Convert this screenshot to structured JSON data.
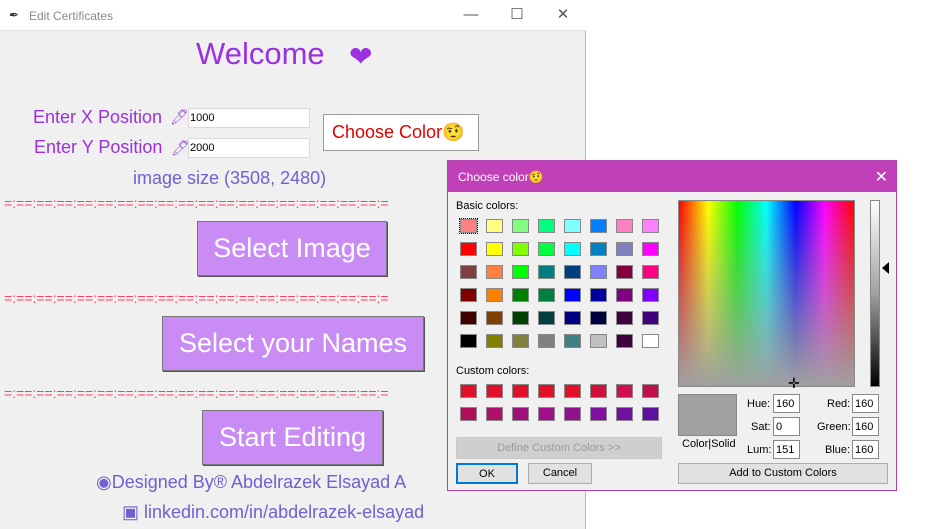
{
  "main_window": {
    "title": "Edit Certificates",
    "controls": {
      "minimize": "—",
      "maximize": "☐",
      "close": "✕"
    },
    "welcome": "Welcome",
    "heart": "❤",
    "x_label": "Enter X Position",
    "x_value": "1000",
    "y_label": "Enter Y Position",
    "y_value": "2000",
    "pen_icon": "🖊",
    "choose_color_label": "Choose Color🤨",
    "image_size": "image size (3508, 2480)",
    "divider": "=:==:==:==:==:==:==:==:==:==:==:==:==:==:==:==:==:==:==:=",
    "select_image": "Select  Image",
    "select_names": "Select your Names",
    "start_editing": "Start Editing",
    "designed_by": "◉Designed By® Abdelrazek Elsayad  A",
    "linkedin": "▣ linkedin.com/in/abdelrazek-elsayad"
  },
  "color_dialog": {
    "title": "Choose color🤨",
    "close": "✕",
    "basic_colors_label": "Basic colors:",
    "custom_colors_label": "Custom colors:",
    "basic_colors": [
      [
        "#ff8080",
        "#ffff80",
        "#80ff80",
        "#00ff80",
        "#80ffff",
        "#0080ff",
        "#ff80c0",
        "#ff80ff"
      ],
      [
        "#ff0000",
        "#ffff00",
        "#80ff00",
        "#00ff40",
        "#00ffff",
        "#0080c0",
        "#8080c0",
        "#ff00ff"
      ],
      [
        "#804040",
        "#ff8040",
        "#00ff00",
        "#008080",
        "#004080",
        "#8080ff",
        "#800040",
        "#ff0080"
      ],
      [
        "#800000",
        "#ff8000",
        "#008000",
        "#008040",
        "#0000ff",
        "#0000a0",
        "#800080",
        "#8000ff"
      ],
      [
        "#400000",
        "#804000",
        "#004000",
        "#004040",
        "#000080",
        "#000040",
        "#400040",
        "#400080"
      ],
      [
        "#000000",
        "#808000",
        "#808040",
        "#808080",
        "#408080",
        "#c0c0c0",
        "#400040",
        "#ffffff"
      ]
    ],
    "custom_colors": [
      [
        "#e0102a",
        "#e0102a",
        "#e0102a",
        "#e0102a",
        "#e0102a",
        "#d0103a",
        "#d0104a",
        "#c0104a"
      ],
      [
        "#b0105a",
        "#b0106a",
        "#a0107a",
        "#a0108a",
        "#901090",
        "#8010a0",
        "#7010a0",
        "#6010a0"
      ]
    ],
    "define_custom": "Define Custom Colors >>",
    "ok": "OK",
    "cancel": "Cancel",
    "color_solid": "Color|Solid",
    "hue_label": "Hue:",
    "hue": "160",
    "sat_label": "Sat:",
    "sat": "0",
    "lum_label": "Lum:",
    "lum": "151",
    "red_label": "Red:",
    "red": "160",
    "green_label": "Green:",
    "green": "160",
    "blue_label": "Blue:",
    "blue": "160",
    "add_custom": "Add to Custom Colors",
    "current_color": "#a0a0a0"
  }
}
